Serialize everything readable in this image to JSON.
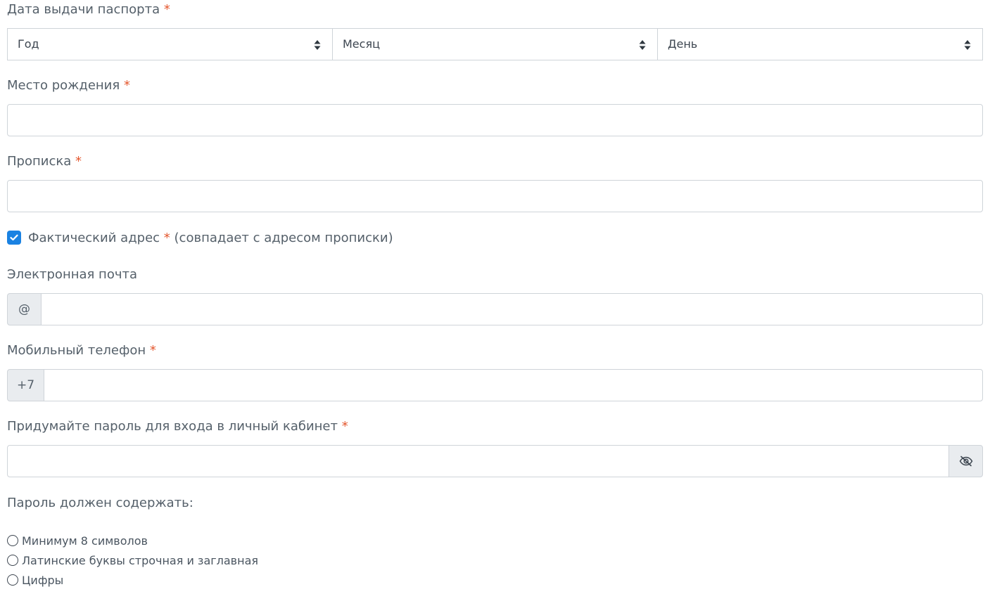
{
  "passport_date": {
    "label": "Дата выдачи паспорта",
    "required_mark": "*",
    "year": "Год",
    "month": "Месяц",
    "day": "День"
  },
  "birthplace": {
    "label": "Место рождения",
    "required_mark": "*",
    "value": ""
  },
  "registration": {
    "label": "Прописка",
    "required_mark": "*",
    "value": ""
  },
  "actual_address": {
    "label": "Фактический адрес",
    "required_mark": "*",
    "suffix": "(совпадает с адресом прописки)",
    "checked": true
  },
  "email": {
    "label": "Электронная почта",
    "addon": "@",
    "value": ""
  },
  "phone": {
    "label": "Мобильный телефон",
    "required_mark": "*",
    "addon": "+7",
    "value": ""
  },
  "password": {
    "label": "Придумайте пароль для входа в личный кабинет",
    "required_mark": "*",
    "value": "",
    "toggle_icon": "eye-slash-icon"
  },
  "password_rules": {
    "title": "Пароль должен содержать:",
    "items": [
      "Минимум 8 символов",
      "Латинские буквы строчная и заглавная",
      "Цифры"
    ]
  },
  "colors": {
    "accent": "#1a82e2",
    "required": "#e4572e",
    "border": "#cfd4d9",
    "addon_bg": "#e9ecef"
  }
}
